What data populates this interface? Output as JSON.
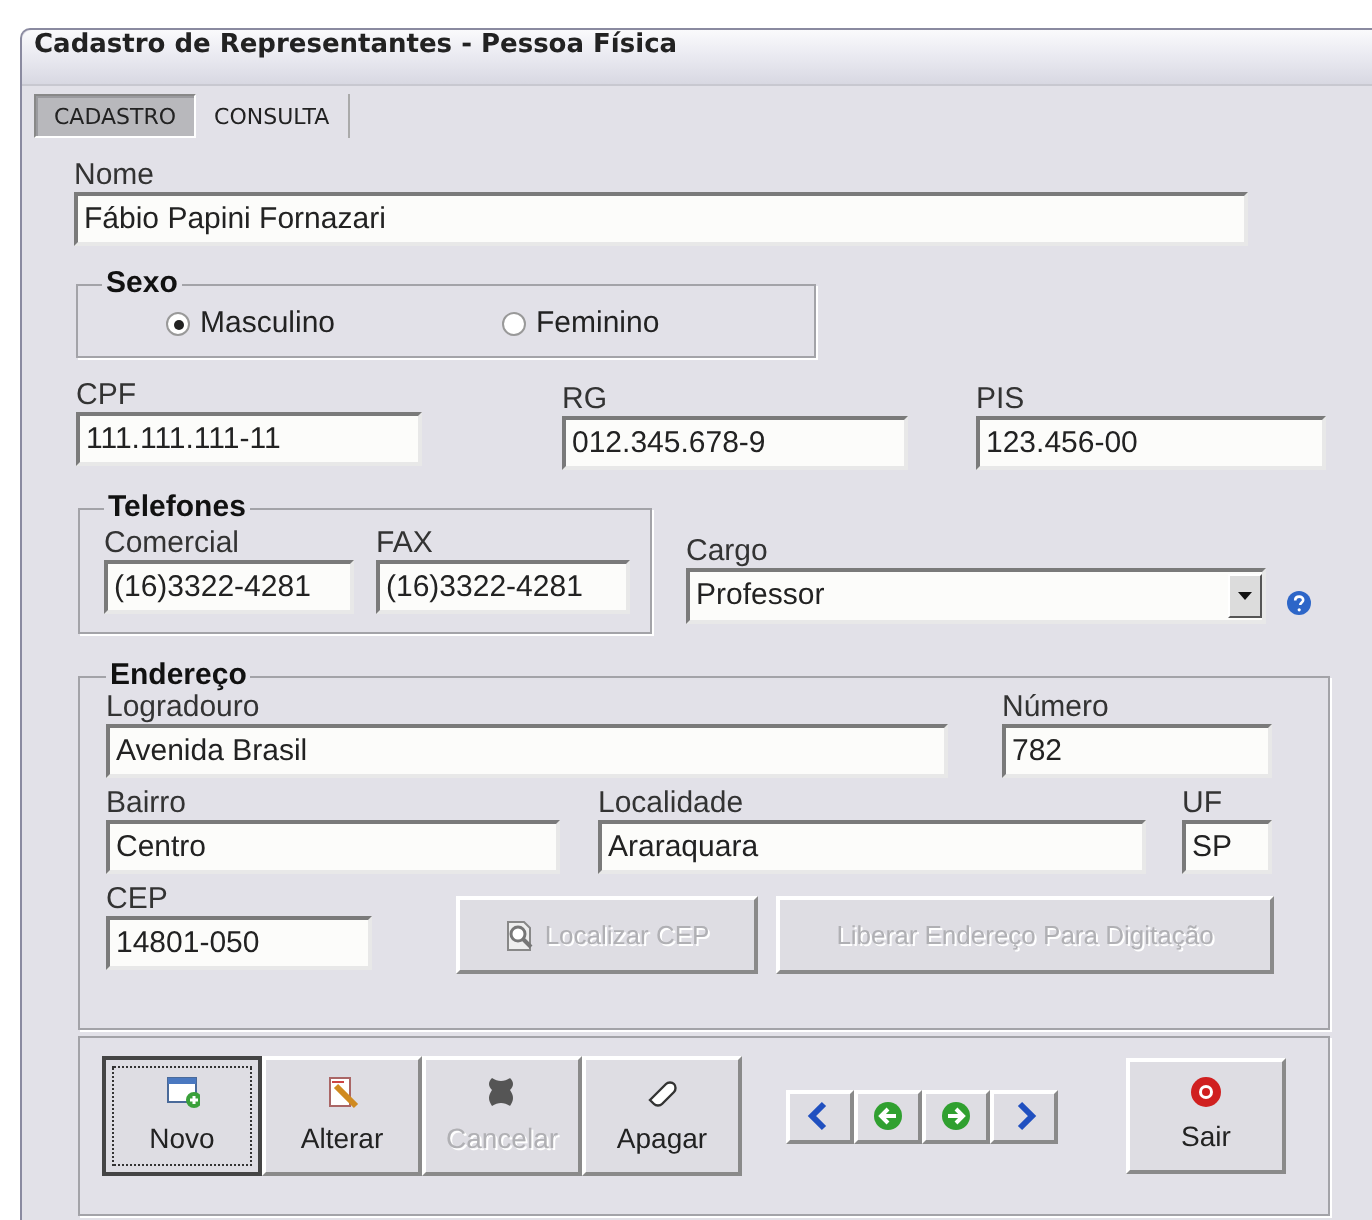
{
  "window": {
    "title": "Cadastro de Representantes - Pessoa Física"
  },
  "tabs": [
    {
      "label": "CADASTRO",
      "selected": true
    },
    {
      "label": "CONSULTA",
      "selected": false
    }
  ],
  "nome": {
    "label": "Nome",
    "value": "Fábio Papini Fornazari"
  },
  "sexo": {
    "legend": "Sexo",
    "options": [
      {
        "label": "Masculino",
        "selected": true
      },
      {
        "label": "Feminino",
        "selected": false
      }
    ]
  },
  "documents": [
    {
      "label": "CPF",
      "value": "111.111.111-11"
    },
    {
      "label": "RG",
      "value": "012.345.678-9"
    },
    {
      "label": "PIS",
      "value": "123.456-00"
    }
  ],
  "telefones": {
    "legend": "Telefones",
    "fields": [
      {
        "label": "Comercial",
        "value": "(16)3322-4281"
      },
      {
        "label": "FAX",
        "value": "(16)3322-4281"
      }
    ]
  },
  "cargo": {
    "label": "Cargo",
    "value": "Professor"
  },
  "endereco": {
    "legend": "Endereço",
    "fields": [
      {
        "label": "Logradouro",
        "value": "Avenida Brasil"
      },
      {
        "label": "Número",
        "value": "782"
      },
      {
        "label": "Bairro",
        "value": "Centro"
      },
      {
        "label": "Localidade",
        "value": "Araraquara"
      },
      {
        "label": "UF",
        "value": "SP"
      },
      {
        "label": "CEP",
        "value": "14801-050"
      }
    ],
    "buttons": [
      {
        "label": "Localizar CEP",
        "disabled": true,
        "kind": "search"
      },
      {
        "label": "Liberar Endereço Para Digitação",
        "disabled": true,
        "kind": "plain"
      }
    ]
  },
  "toolbar": {
    "actions": [
      {
        "label": "Novo",
        "kind": "new",
        "disabled": false,
        "focused": true
      },
      {
        "label": "Alterar",
        "kind": "edit",
        "disabled": false,
        "focused": false
      },
      {
        "label": "Cancelar",
        "kind": "cancel",
        "disabled": true,
        "focused": false
      },
      {
        "label": "Apagar",
        "kind": "erase",
        "disabled": false,
        "focused": false
      }
    ],
    "exit": {
      "label": "Sair"
    }
  }
}
